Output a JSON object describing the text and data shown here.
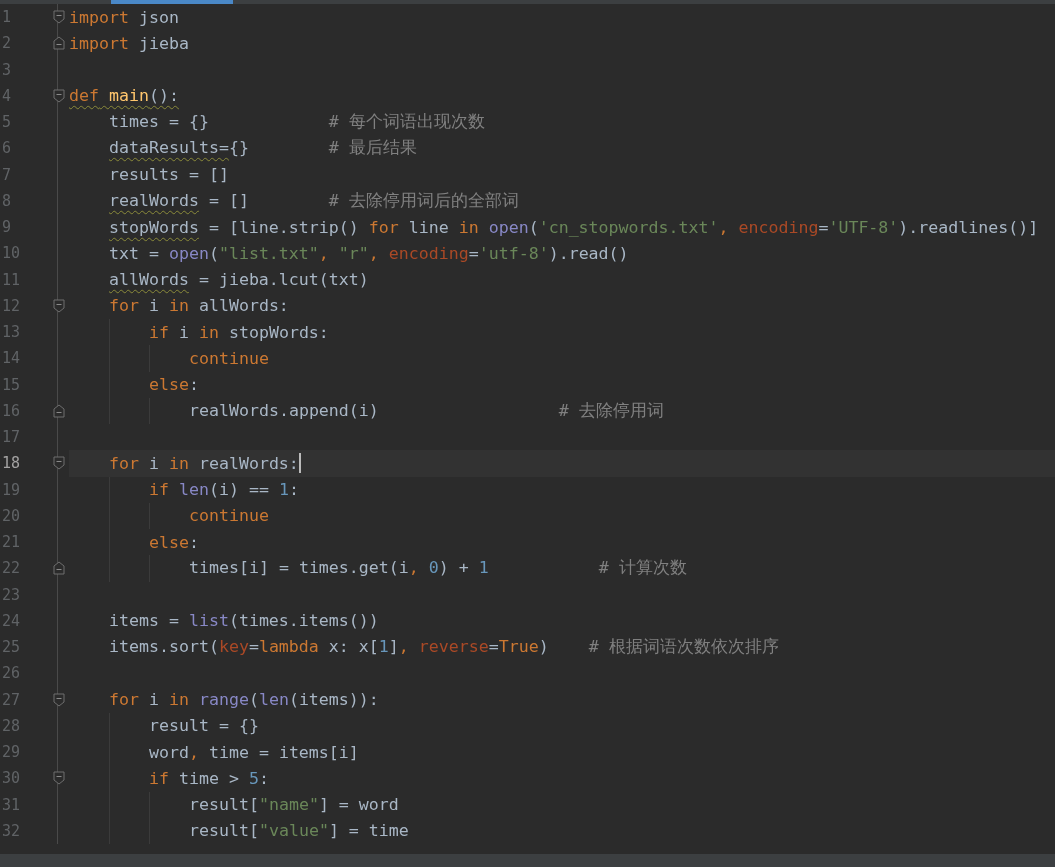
{
  "editor": {
    "lines": [
      {
        "number": "1",
        "kind": "fold-start",
        "current": false,
        "tokens": [
          {
            "kind": "kw",
            "text": "import"
          },
          {
            "kind": "tx",
            "text": " json"
          }
        ]
      },
      {
        "number": "2",
        "kind": "fold-end",
        "current": false,
        "tokens": [
          {
            "kind": "kw",
            "text": "import"
          },
          {
            "kind": "tx",
            "text": " jieba"
          }
        ]
      },
      {
        "number": "3",
        "kind": "plain",
        "current": false
      },
      {
        "number": "4",
        "kind": "fold-start",
        "current": false,
        "tokens": [
          {
            "kind": "kw_w",
            "text": "def"
          },
          {
            "kind": "fn_w",
            "text": " main"
          },
          {
            "kind": "tx_w",
            "text": "():"
          }
        ],
        "children": [
          {
            "number": "5",
            "kind": "plain",
            "current": false,
            "tokens": [
              {
                "kind": "tx",
                "text": "times = {}"
              },
              {
                "kind": "cm",
                "text": "            # 每个词语出现次数"
              }
            ]
          },
          {
            "number": "6",
            "kind": "plain",
            "current": false,
            "tokens": [
              {
                "kind": "tx_w",
                "text": "dataResults="
              },
              {
                "kind": "tx",
                "text": "{}"
              },
              {
                "kind": "cm",
                "text": "        # 最后结果"
              }
            ]
          },
          {
            "number": "7",
            "kind": "plain",
            "current": false,
            "tokens": [
              {
                "kind": "tx",
                "text": "results = []"
              }
            ]
          },
          {
            "number": "8",
            "kind": "plain",
            "current": false,
            "tokens": [
              {
                "kind": "tx_w",
                "text": "realWords"
              },
              {
                "kind": "tx",
                "text": " = []"
              },
              {
                "kind": "cm",
                "text": "        # 去除停用词后的全部词"
              }
            ]
          },
          {
            "number": "9",
            "kind": "plain",
            "current": false,
            "tokens": [
              {
                "kind": "tx_w",
                "text": "stopWords"
              },
              {
                "kind": "tx",
                "text": " = [line.strip() "
              },
              {
                "kind": "kw",
                "text": "for"
              },
              {
                "kind": "tx",
                "text": " line "
              },
              {
                "kind": "kw",
                "text": "in "
              },
              {
                "kind": "bi",
                "text": "open"
              },
              {
                "kind": "tx",
                "text": "("
              },
              {
                "kind": "st",
                "text": "'cn_stopwords.txt'"
              },
              {
                "kind": "kw",
                "text": ", "
              },
              {
                "kind": "pm",
                "text": "encoding"
              },
              {
                "kind": "tx",
                "text": "="
              },
              {
                "kind": "st",
                "text": "'UTF-8'"
              },
              {
                "kind": "tx",
                "text": ").readlines()]"
              }
            ]
          },
          {
            "number": "10",
            "kind": "plain",
            "current": false,
            "tokens": [
              {
                "kind": "tx",
                "text": "txt = "
              },
              {
                "kind": "bi",
                "text": "open"
              },
              {
                "kind": "tx",
                "text": "("
              },
              {
                "kind": "st",
                "text": "\"list.txt\""
              },
              {
                "kind": "kw",
                "text": ", "
              },
              {
                "kind": "st",
                "text": "\"r\""
              },
              {
                "kind": "kw",
                "text": ", "
              },
              {
                "kind": "pm",
                "text": "encoding"
              },
              {
                "kind": "tx",
                "text": "="
              },
              {
                "kind": "st",
                "text": "'utf-8'"
              },
              {
                "kind": "tx",
                "text": ").read()"
              }
            ]
          },
          {
            "number": "11",
            "kind": "plain",
            "current": false,
            "tokens": [
              {
                "kind": "tx_w",
                "text": "allWords"
              },
              {
                "kind": "tx",
                "text": " = jieba.lcut(txt)"
              }
            ]
          },
          {
            "number": "12",
            "kind": "fold-start",
            "current": false,
            "tokens": [
              {
                "kind": "kw",
                "text": "for"
              },
              {
                "kind": "tx",
                "text": " i "
              },
              {
                "kind": "kw",
                "text": "in"
              },
              {
                "kind": "tx",
                "text": " allWords:"
              }
            ],
            "children": [
              {
                "number": "13",
                "kind": "plain",
                "current": false,
                "tokens": [
                  {
                    "kind": "kw",
                    "text": "if"
                  },
                  {
                    "kind": "tx",
                    "text": " i "
                  },
                  {
                    "kind": "kw",
                    "text": "in"
                  },
                  {
                    "kind": "tx",
                    "text": " stopWords:"
                  }
                ],
                "children": [
                  {
                    "number": "14",
                    "kind": "plain",
                    "current": false,
                    "tokens": [
                      {
                        "kind": "kw",
                        "text": "continue"
                      }
                    ]
                  }
                ]
              },
              {
                "number": "15",
                "kind": "plain",
                "current": false,
                "tokens": [
                  {
                    "kind": "kw",
                    "text": "else"
                  },
                  {
                    "kind": "tx",
                    "text": ":"
                  }
                ],
                "children": [
                  {
                    "number": "16",
                    "kind": "fold-end",
                    "current": false,
                    "tokens": [
                      {
                        "kind": "tx",
                        "text": "realWords.append(i)"
                      },
                      {
                        "kind": "cm",
                        "text": "                  # 去除停用词"
                      }
                    ]
                  }
                ]
              }
            ]
          },
          {
            "number": "17",
            "kind": "plain",
            "current": false
          },
          {
            "number": "18",
            "kind": "fold-start",
            "current": true,
            "tokens": [
              {
                "kind": "kw",
                "text": "for"
              },
              {
                "kind": "tx",
                "text": " i "
              },
              {
                "kind": "kw",
                "text": "in"
              },
              {
                "kind": "tx",
                "text": " realWords:"
              }
            ],
            "children": [
              {
                "number": "19",
                "kind": "plain",
                "current": false,
                "tokens": [
                  {
                    "kind": "kw",
                    "text": "if "
                  },
                  {
                    "kind": "bi",
                    "text": "len"
                  },
                  {
                    "kind": "tx",
                    "text": "(i) == "
                  },
                  {
                    "kind": "nm",
                    "text": "1"
                  },
                  {
                    "kind": "tx",
                    "text": ":"
                  }
                ],
                "children": [
                  {
                    "number": "20",
                    "kind": "plain",
                    "current": false,
                    "tokens": [
                      {
                        "kind": "kw",
                        "text": "continue"
                      }
                    ]
                  }
                ]
              },
              {
                "number": "21",
                "kind": "plain",
                "current": false,
                "tokens": [
                  {
                    "kind": "kw",
                    "text": "else"
                  },
                  {
                    "kind": "tx",
                    "text": ":"
                  }
                ],
                "children": [
                  {
                    "number": "22",
                    "kind": "fold-end",
                    "current": false,
                    "tokens": [
                      {
                        "kind": "tx",
                        "text": "times[i] = times.get(i"
                      },
                      {
                        "kind": "kw",
                        "text": ", "
                      },
                      {
                        "kind": "nm",
                        "text": "0"
                      },
                      {
                        "kind": "tx",
                        "text": ") + "
                      },
                      {
                        "kind": "nm",
                        "text": "1"
                      },
                      {
                        "kind": "cm",
                        "text": "           # 计算次数"
                      }
                    ]
                  }
                ]
              }
            ]
          },
          {
            "number": "23",
            "kind": "plain",
            "current": false
          },
          {
            "number": "24",
            "kind": "plain",
            "current": false,
            "tokens": [
              {
                "kind": "tx",
                "text": "items = "
              },
              {
                "kind": "bi",
                "text": "list"
              },
              {
                "kind": "tx",
                "text": "(times.items())"
              }
            ]
          },
          {
            "number": "25",
            "kind": "plain",
            "current": false,
            "tokens": [
              {
                "kind": "tx",
                "text": "items.sort("
              },
              {
                "kind": "pm",
                "text": "key"
              },
              {
                "kind": "tx",
                "text": "="
              },
              {
                "kind": "kw",
                "text": "lambda"
              },
              {
                "kind": "tx",
                "text": " x: x["
              },
              {
                "kind": "nm",
                "text": "1"
              },
              {
                "kind": "tx",
                "text": "]"
              },
              {
                "kind": "kw",
                "text": ", "
              },
              {
                "kind": "pm",
                "text": "reverse"
              },
              {
                "kind": "tx",
                "text": "="
              },
              {
                "kind": "kw",
                "text": "True"
              },
              {
                "kind": "tx",
                "text": ")"
              },
              {
                "kind": "cm",
                "text": "    # 根据词语次数依次排序"
              }
            ]
          },
          {
            "number": "26",
            "kind": "plain",
            "current": false
          },
          {
            "number": "27",
            "kind": "fold-start",
            "current": false,
            "tokens": [
              {
                "kind": "kw",
                "text": "for"
              },
              {
                "kind": "tx",
                "text": " i "
              },
              {
                "kind": "kw",
                "text": "in "
              },
              {
                "kind": "bi",
                "text": "range"
              },
              {
                "kind": "tx",
                "text": "("
              },
              {
                "kind": "bi",
                "text": "len"
              },
              {
                "kind": "tx",
                "text": "(items)):"
              }
            ],
            "children": [
              {
                "number": "28",
                "kind": "plain",
                "current": false,
                "tokens": [
                  {
                    "kind": "tx",
                    "text": "result = {}"
                  }
                ]
              },
              {
                "number": "29",
                "kind": "plain",
                "current": false,
                "tokens": [
                  {
                    "kind": "tx",
                    "text": "word"
                  },
                  {
                    "kind": "kw",
                    "text": ", "
                  },
                  {
                    "kind": "tx",
                    "text": "time = items[i]"
                  }
                ]
              },
              {
                "number": "30",
                "kind": "fold-start",
                "current": false,
                "tokens": [
                  {
                    "kind": "kw",
                    "text": "if"
                  },
                  {
                    "kind": "tx",
                    "text": " time > "
                  },
                  {
                    "kind": "nm",
                    "text": "5"
                  },
                  {
                    "kind": "tx",
                    "text": ":"
                  }
                ],
                "children": [
                  {
                    "number": "31",
                    "kind": "plain",
                    "current": false,
                    "tokens": [
                      {
                        "kind": "tx",
                        "text": "result["
                      },
                      {
                        "kind": "st",
                        "text": "\"name\""
                      },
                      {
                        "kind": "tx",
                        "text": "] = word"
                      }
                    ]
                  },
                  {
                    "number": "32",
                    "kind": "plain",
                    "current": false,
                    "tokens": [
                      {
                        "kind": "tx",
                        "text": "result["
                      },
                      {
                        "kind": "st",
                        "text": "\"value\""
                      },
                      {
                        "kind": "tx",
                        "text": "] = time"
                      }
                    ]
                  }
                ]
              }
            ]
          }
        ]
      }
    ]
  }
}
